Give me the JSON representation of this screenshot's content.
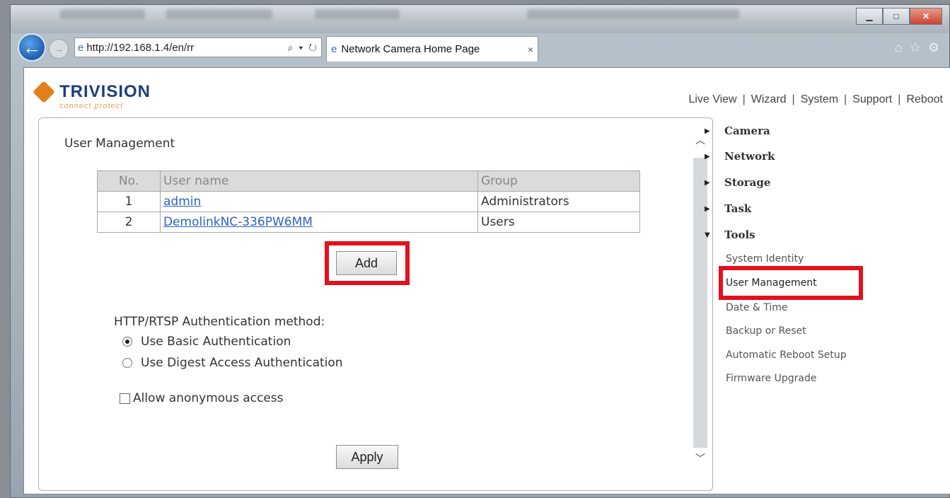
{
  "browser": {
    "address": "http://192.168.1.4/en/rr",
    "tab_title": "Network Camera Home Page",
    "tab_close": "×"
  },
  "header": {
    "logo_word": "TRIVISION",
    "logo_tagline": "connect protect",
    "nav": [
      "Live View",
      "Wizard",
      "System",
      "Support",
      "Reboot"
    ]
  },
  "main": {
    "title": "User Management",
    "table": {
      "headers": [
        "No.",
        "User name",
        "Group"
      ],
      "rows": [
        {
          "no": "1",
          "name": "admin",
          "group": "Administrators"
        },
        {
          "no": "2",
          "name": "DemolinkNC-336PW6MM",
          "group": "Users"
        }
      ]
    },
    "add_label": "Add",
    "auth_label": "HTTP/RTSP Authentication method:",
    "auth_options": [
      {
        "label": "Use Basic Authentication",
        "selected": true
      },
      {
        "label": "Use Digest Access Authentication",
        "selected": false
      }
    ],
    "anonymous_label": "Allow anonymous access",
    "anonymous_checked": false,
    "apply_label": "Apply"
  },
  "sidebar": {
    "sections": [
      {
        "label": "Camera",
        "expanded": false
      },
      {
        "label": "Network",
        "expanded": false
      },
      {
        "label": "Storage",
        "expanded": false
      },
      {
        "label": "Task",
        "expanded": false
      },
      {
        "label": "Tools",
        "expanded": true
      }
    ],
    "tools_items": [
      "System Identity",
      "User Management",
      "Date & Time",
      "Backup or Reset",
      "Automatic Reboot Setup",
      "Firmware Upgrade"
    ],
    "active_item": "User Management"
  },
  "colors": {
    "highlight": "#e3111c",
    "link": "#2a64c5",
    "logo_blue": "#1d3f79",
    "logo_orange": "#e47f1e"
  }
}
